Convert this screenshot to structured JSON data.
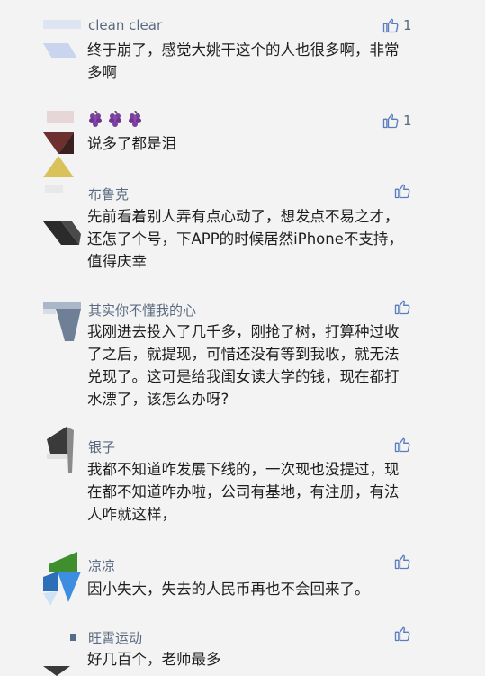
{
  "comments": [
    {
      "name": "clean clear",
      "text": "终于崩了，感觉大姚干这个的人也很多啊，非常多啊",
      "likes": "1"
    },
    {
      "name": "",
      "text": "说多了都是泪",
      "likes": "1",
      "name_emoji": "grape-emoji"
    },
    {
      "name": "布鲁克",
      "text": "先前看着别人弄有点心动了，想发点不易之才，还怎了个号，下APP的时候居然iPhone不支持，值得庆幸",
      "likes": ""
    },
    {
      "name": "其实你不懂我的心",
      "text": "我刚进去投入了几千多，刚抢了树，打算种过收了之后，就提现，可惜还没有等到我收，就无法兑现了。这可是给我闺女读大学的钱，现在都打水漂了，该怎么办呀?",
      "likes": ""
    },
    {
      "name": "银子",
      "text": "我都不知道咋发展下线的，一次现也没提过，现在都不知道咋办啦，公司有基地，有注册，有法人咋就这样，",
      "likes": ""
    },
    {
      "name": "凉凉",
      "text": "因小失大，失去的人民币再也不会回来了。",
      "likes": ""
    },
    {
      "name": "旺霄运动",
      "text": "好几百个，老师最多",
      "likes": ""
    }
  ],
  "icons": {
    "like": "thumbs-up-icon",
    "grape": "grape-emoji"
  },
  "colors": {
    "background": "#f3f3f3",
    "username": "#5a6b80",
    "text": "#1e1e1e"
  }
}
